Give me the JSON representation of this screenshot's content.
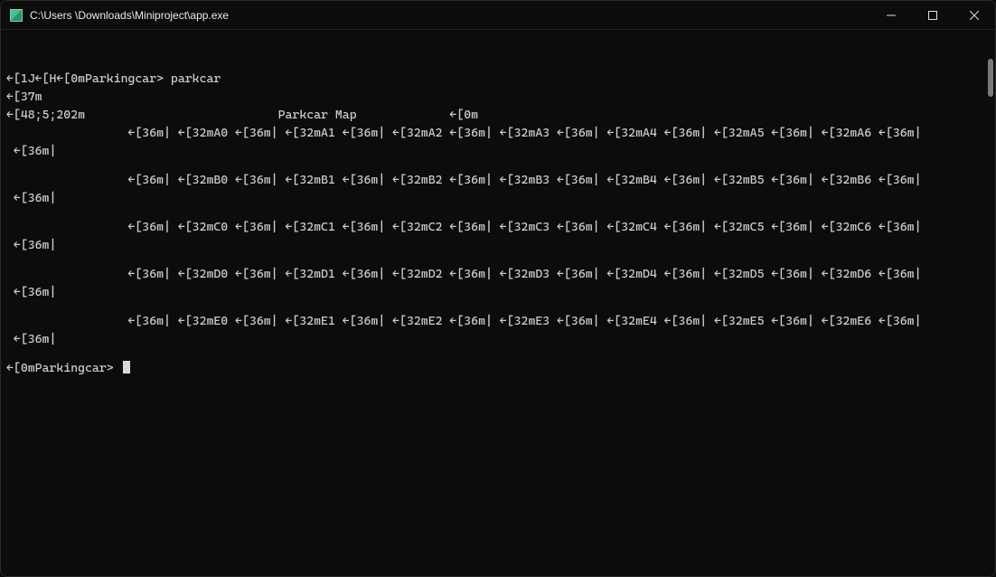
{
  "window": {
    "title": "C:\\Users           \\Downloads\\Miniproject\\app.exe"
  },
  "esc": {
    "arrow": "←",
    "reset_seq": "[0m",
    "cyan_seq": "[36m",
    "green_seq": "[32m",
    "fg37_seq": "[37m",
    "orange_seq": "[48;5;202m",
    "clear_seq": "[1J",
    "home_seq": "[H",
    "pipe": "|"
  },
  "prompt": {
    "name": "Parkingcar",
    "command": "parkcar",
    "chevron": ">"
  },
  "header": {
    "title_text": "Parkcar Map"
  },
  "map": {
    "rows": [
      "A",
      "B",
      "C",
      "D",
      "E"
    ],
    "cols": [
      "0",
      "1",
      "2",
      "3",
      "4",
      "5",
      "6"
    ]
  }
}
